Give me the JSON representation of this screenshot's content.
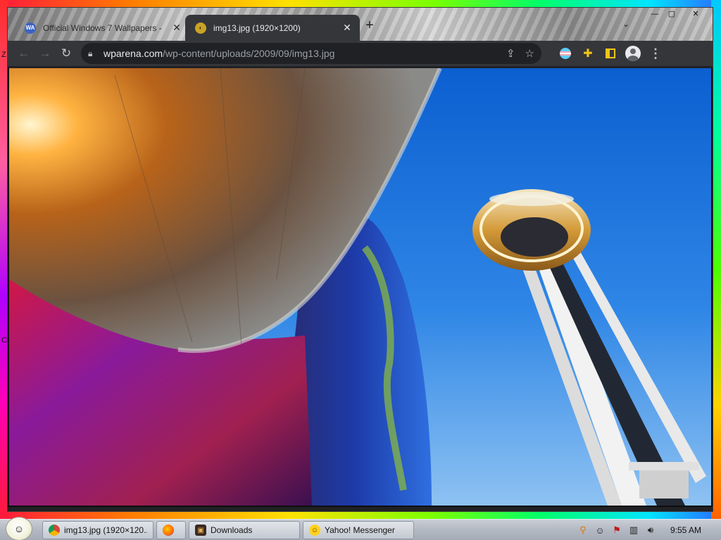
{
  "desktop": {
    "stray_letters": [
      "Z",
      "C"
    ]
  },
  "browser": {
    "tabs": [
      {
        "title": "Official Windows 7 Wallpapers -",
        "favicon": "WA",
        "active": false
      },
      {
        "title": "img13.jpg (1920×1200)",
        "favicon": "img-favicon",
        "active": true
      }
    ],
    "new_tab_label": "+",
    "tab_search_label": "⌄",
    "window_controls": {
      "minimize": "—",
      "maximize": "▢",
      "close": "✕"
    },
    "toolbar": {
      "back_icon": "arrow-left-icon",
      "forward_icon": "arrow-right-icon",
      "reload_icon": "reload-icon",
      "url_host": "wparena.com",
      "url_path": "/wp-content/uploads/2009/09/img13.jpg",
      "share_icon": "share-icon",
      "bookmark_icon": "star-icon",
      "extensions": [
        "pride-flag-extension-icon",
        "puzzle-extensions-icon",
        "side-panel-icon"
      ],
      "profile_icon": "profile-avatar-icon",
      "menu_icon": "kebab-menu-icon"
    },
    "content": {
      "image_alt": "Space Needle next to a curved reflective building under a blue sky"
    }
  },
  "taskbar": {
    "start_orb_icon": "start-orb-icon",
    "items": [
      {
        "label": "img13.jpg (1920×120...",
        "icon": "chrome-icon"
      },
      {
        "label": "",
        "icon": "firefox-icon"
      },
      {
        "label": "Downloads",
        "icon": "folder-icon"
      },
      {
        "label": "Yahoo! Messenger",
        "icon": "yahoo-messenger-icon"
      }
    ],
    "tray_icons": [
      "search-tray-icon",
      "smiley-tray-icon",
      "flag-tray-icon",
      "network-tray-icon",
      "volume-tray-icon"
    ],
    "clock": "9:55 AM"
  },
  "colors": {
    "browser_dark": "#202124",
    "toolbar": "#35363a",
    "sky": "#1a78e0",
    "taskbar": "#b3b9c3"
  }
}
